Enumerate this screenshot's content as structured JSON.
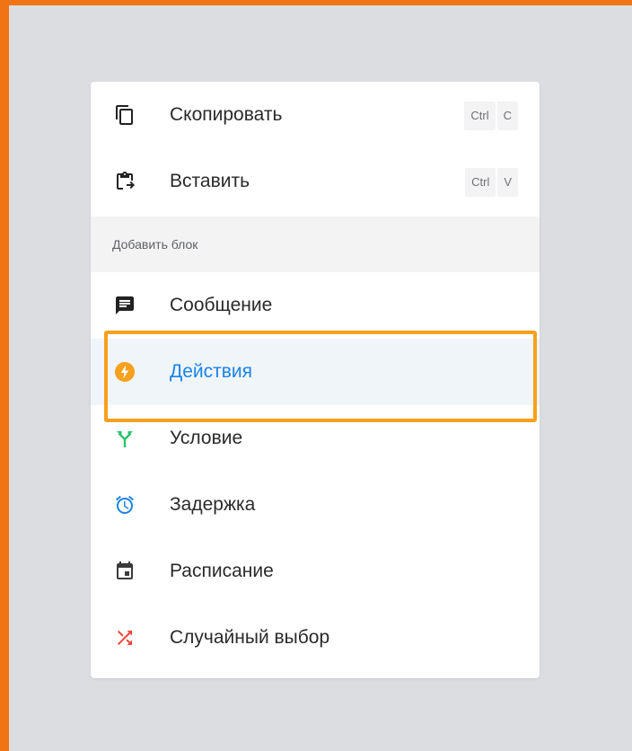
{
  "menu": {
    "copy": {
      "label": "Скопировать",
      "icon": "copy-icon",
      "shortcut": [
        "Ctrl",
        "C"
      ]
    },
    "paste": {
      "label": "Вставить",
      "icon": "paste-icon",
      "shortcut": [
        "Ctrl",
        "V"
      ]
    },
    "section_header": "Добавить блок",
    "blocks": [
      {
        "label": "Сообщение",
        "icon": "message-icon",
        "color": "#2a2a2a"
      },
      {
        "label": "Действия",
        "icon": "lightning-icon",
        "color": "#f7a01c",
        "active": true
      },
      {
        "label": "Условие",
        "icon": "split-arrows-icon",
        "color": "#2cc36b"
      },
      {
        "label": "Задержка",
        "icon": "alarm-clock-icon",
        "color": "#1a83e6"
      },
      {
        "label": "Расписание",
        "icon": "calendar-icon",
        "color": "#3a3a3a"
      },
      {
        "label": "Случайный выбор",
        "icon": "shuffle-icon",
        "color": "#f04438"
      }
    ]
  },
  "colors": {
    "frame_border": "#f07414",
    "background": "#dcdde0",
    "active_text": "#1a83e6",
    "highlight_border": "#f7a01c"
  }
}
